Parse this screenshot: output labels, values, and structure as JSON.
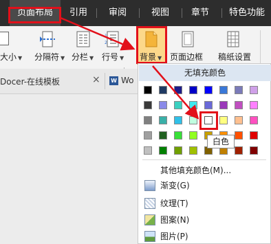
{
  "menu": {
    "tabs": [
      "页面布局",
      "引用",
      "审阅",
      "视图",
      "章节",
      "特色功能"
    ]
  },
  "ribbon": {
    "size_label": "大小",
    "columns_label": "分栏",
    "line_number_label": "行号",
    "separator_label": "分隔符",
    "background_label": "背景",
    "page_border_label": "页面边框",
    "manuscript_label": "稿纸设置"
  },
  "tabs": {
    "docer_label": "Docer-在线模板",
    "doc_label": "Wo",
    "close_glyph": "×"
  },
  "dropdown": {
    "no_fill_label": "无填充颜色",
    "more_colors_label": "其他填充颜色(M)...",
    "gradient_label": "渐变(G)",
    "texture_label": "纹理(T)",
    "pattern_label": "图案(N)",
    "picture_label": "图片(P)",
    "tooltip": "白色",
    "palette": [
      [
        "#000000",
        "#1f3a63",
        "#1c1c8a",
        "#0000c8",
        "#0000ff",
        "#3a78d8",
        "#7b7bb9",
        "#cfa0e8"
      ],
      [
        "#3a3a3a",
        "#8a8ae8",
        "#3bd0c0",
        "#40e8f0",
        "#6a6ad8",
        "#9a3ab9",
        "#c050c0",
        "#ff80ff"
      ],
      [
        "#808080",
        "#3ab0a8",
        "#30c0e8",
        "#c0ffe0",
        "#ffffff",
        "#ffff80",
        "#ffc090",
        "#ff50c0"
      ],
      [
        "#a0a0a0",
        "#206020",
        "#38e038",
        "#90ff20",
        "#c8a000",
        "#ff9000",
        "#ff5000",
        "#e00000"
      ],
      [
        "#c0c0c0",
        "#008000",
        "#70a000",
        "#a0c000",
        "#806000",
        "#c08000",
        "#a02000",
        "#800000"
      ]
    ]
  }
}
